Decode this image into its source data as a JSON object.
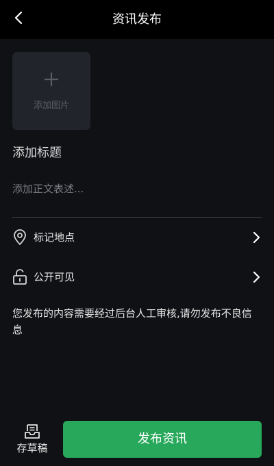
{
  "header": {
    "title": "资讯发布",
    "back_icon": "chevron-left-icon"
  },
  "image_picker": {
    "label": "添加图片",
    "icon": "plus-icon"
  },
  "form": {
    "title_placeholder": "添加标题",
    "body_placeholder": "添加正文表述..."
  },
  "options": [
    {
      "icon": "location-pin-icon",
      "label": "标记地点"
    },
    {
      "icon": "unlock-icon",
      "label": "公开可见"
    }
  ],
  "notice": "您发布的内容需要经过后台人工审核,请勿发布不良信息",
  "footer": {
    "draft_label": "存草稿",
    "draft_icon": "inbox-icon",
    "publish_label": "发布资讯"
  },
  "colors": {
    "background": "#101114",
    "header": "#000000",
    "accent": "#27a85a",
    "tile": "#22242c"
  }
}
